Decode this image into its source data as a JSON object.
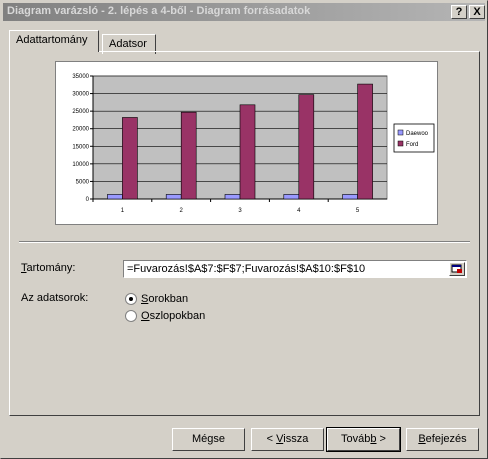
{
  "window": {
    "title": "Diagram varázsló - 2. lépés a 4-ből - Diagram forrásadatok",
    "help_button": "?",
    "close_button": "X"
  },
  "tabs": [
    {
      "label": "Adattartomány",
      "active": true
    },
    {
      "label": "Adatsor",
      "active": false
    }
  ],
  "chart_data": {
    "type": "bar",
    "categories": [
      "1",
      "2",
      "3",
      "4",
      "5"
    ],
    "series": [
      {
        "name": "Daewoo",
        "values": [
          1300,
          1300,
          1300,
          1300,
          1300
        ],
        "color": "#9999ff"
      },
      {
        "name": "Ford",
        "values": [
          23200,
          24700,
          26800,
          29700,
          32700
        ],
        "color": "#993366"
      }
    ],
    "y_ticks": [
      "0",
      "5000",
      "10000",
      "15000",
      "20000",
      "25000",
      "30000",
      "35000"
    ],
    "ylim": [
      0,
      35000
    ],
    "plot_background": "#c0c0c0",
    "grid": true,
    "legend": "right"
  },
  "range": {
    "label": "Tartomány:",
    "value": "=Fuvarozás!$A$7:$F$7;Fuvarozás!$A$10:$F$10"
  },
  "series_in": {
    "label": "Az adatsorok:",
    "options": [
      {
        "label": "Sorokban",
        "selected": true
      },
      {
        "label": "Oszlopokban",
        "selected": false
      }
    ]
  },
  "buttons": {
    "cancel": "Mégse",
    "back": "< Vissza",
    "next": "Tovább >",
    "finish": "Befejezés"
  }
}
